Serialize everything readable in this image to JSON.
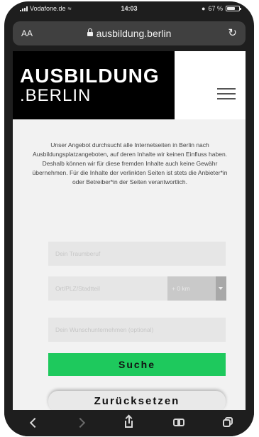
{
  "status_bar": {
    "carrier": "Vodafone.de",
    "time": "14:03",
    "battery": "67 %",
    "battery_level": 0.67
  },
  "browser": {
    "text_size_label": "AA",
    "url": "ausbildung.berlin"
  },
  "site": {
    "logo_line1": "AUSBILDUNG",
    "logo_line2": ".BERLIN"
  },
  "disclaimer": "Unser Angebot durchsucht alle Internetseiten in Berlin nach Ausbildungsplatzangeboten, auf deren Inhalte wir keinen Einfluss haben. Deshalb können wir für diese fremden Inhalte auch keine Gewähr übernehmen. Für die Inhalte der verlinkten Seiten ist stets die Anbieter*in oder Betreiber*in der Seiten verantwortlich.",
  "form": {
    "traumberuf_placeholder": "Dein Traumberuf",
    "ort_placeholder": "Ort/PLZ/Stadtteil",
    "radius_value": "+ 0 km",
    "unternehmen_placeholder": "Dein Wunschunternehmen (optional)",
    "search_label": "Suche",
    "reset_label": "Zurücksetzen"
  },
  "colors": {
    "search_button": "#1ec95d",
    "logo_background": "#000000"
  }
}
